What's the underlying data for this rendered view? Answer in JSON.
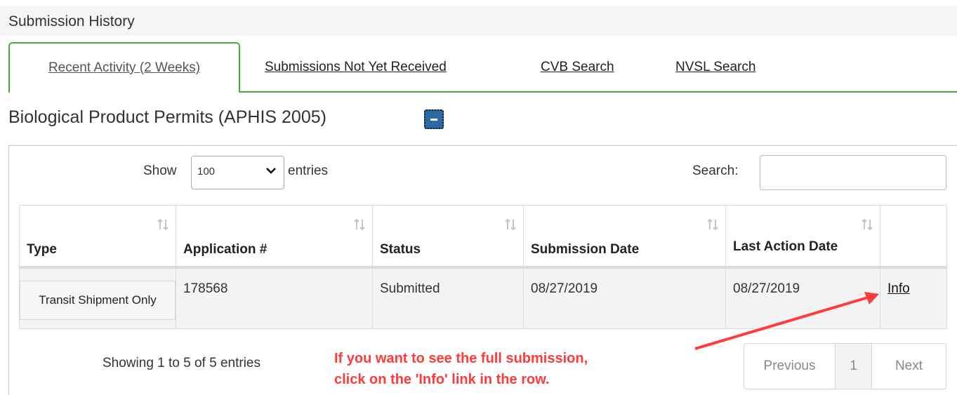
{
  "section": {
    "title": "Submission History"
  },
  "tabs": [
    {
      "label": "Recent Activity (2 Weeks)",
      "active": true
    },
    {
      "label": "Submissions Not Yet Received"
    },
    {
      "label": "CVB Search"
    },
    {
      "label": "NVSL Search"
    }
  ],
  "product": {
    "title": "Biological Product Permits (APHIS 2005)",
    "collapse_icon": "minus-icon"
  },
  "table_controls": {
    "show_label": "Show",
    "page_length": "100",
    "entries_label": "entries",
    "search_label": "Search:",
    "search_value": ""
  },
  "columns": [
    "Type",
    "Application #",
    "Status",
    "Submission Date",
    "Last Action Date",
    ""
  ],
  "rows": [
    {
      "type": "Transit Shipment Only",
      "application": "178568",
      "status": "Submitted",
      "submission_date": "08/27/2019",
      "last_action_date": "08/27/2019",
      "link": "Info"
    }
  ],
  "footer": {
    "info": "Showing 1 to 5 of 5 entries",
    "previous": "Previous",
    "page": "1",
    "next": "Next"
  },
  "annotation": {
    "line1": "If you want to see the full submission,",
    "line2": "click on the 'Info' link in the row.",
    "color": "#ff3b3b"
  },
  "colors": {
    "accent_green": "#4caa3c",
    "button_blue": "#2d6aa4"
  }
}
